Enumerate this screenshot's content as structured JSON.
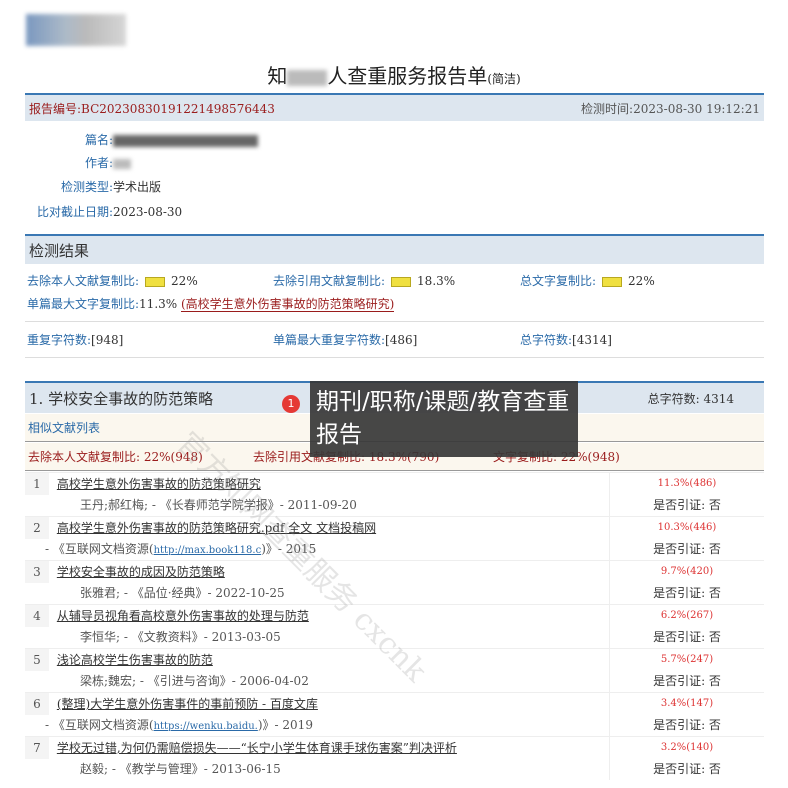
{
  "logo": "CX 知网查重",
  "title": {
    "prefix": "知",
    "suffix": "人查重服务报告单",
    "note": "(简洁)"
  },
  "report": {
    "id_label": "报告编号:",
    "id": "BC20230830191221498576443",
    "time_label": "检测时间:",
    "time": "2023-08-30 19:12:21"
  },
  "fields": {
    "title_label": "篇名:",
    "author_label": "作者:",
    "type_label": "检测类型:",
    "type": "学术出版",
    "date_label": "比对截止日期:",
    "date": "2023-08-30"
  },
  "results": {
    "header": "检测结果",
    "self_label": "去除本人文献复制比:",
    "self": "22%",
    "quote_label": "去除引用文献复制比:",
    "quote": "18.3%",
    "total_label": "总文字复制比:",
    "total": "22%",
    "max_label": "单篇最大文字复制比:",
    "max": "11.3%",
    "max_doc": "(高校学生意外伤害事故的防范策略研究)",
    "dup_label": "重复字符数:",
    "dup": "[948]",
    "maxdup_label": "单篇最大重复字符数:",
    "maxdup": "[486]",
    "chars_label": "总字符数:",
    "chars": "[4314]"
  },
  "section": {
    "title": "1. 学校安全事故的防范策略",
    "chars": "总字符数: 4314",
    "list_label": "相似文献列表",
    "self": "去除本人文献复制比: 22%(948)",
    "quote": "去除引用文献复制比: 18.3%(790)",
    "text": "文字复制比: 22%(948)"
  },
  "items": [
    {
      "n": "1",
      "title": "高校学生意外伤害事故的防范策略研究",
      "pct": "11.3%(486)",
      "meta": "王丹;郝红梅; - 《长春师范学院学报》- 2011-09-20",
      "link": "",
      "meta2": "",
      "cite": "是否引证: 否"
    },
    {
      "n": "2",
      "title": "高校学生意外伤害事故的防范策略研究.pdf 全文 文档投稿网",
      "pct": "10.3%(446)",
      "meta": "- 《互联网文档资源(",
      "link": "http://max.book118.c",
      "meta2": ")》- 2015",
      "cite": "是否引证: 否"
    },
    {
      "n": "3",
      "title": "学校安全事故的成因及防范策略",
      "pct": "9.7%(420)",
      "meta": "张雅君; - 《品位·经典》- 2022-10-25",
      "link": "",
      "meta2": "",
      "cite": "是否引证: 否"
    },
    {
      "n": "4",
      "title": "从辅导员视角看高校意外伤害事故的处理与防范",
      "pct": "6.2%(267)",
      "meta": "李恒华; - 《文教资料》- 2013-03-05",
      "link": "",
      "meta2": "",
      "cite": "是否引证: 否"
    },
    {
      "n": "5",
      "title": "浅论高校学生伤害事故的防范",
      "pct": "5.7%(247)",
      "meta": "梁栋;魏宏; - 《引进与咨询》- 2006-04-02",
      "link": "",
      "meta2": "",
      "cite": "是否引证: 否"
    },
    {
      "n": "6",
      "title": "(整理)大学生意外伤害事件的事前预防 - 百度文库",
      "pct": "3.4%(147)",
      "meta": "- 《互联网文档资源(",
      "link": "https://wenku.baidu.",
      "meta2": ")》- 2019",
      "cite": "是否引证: 否"
    },
    {
      "n": "7",
      "title": "学校无过错,为何仍需赔偿损失——“长宁小学生体育课手球伤害案”判决评析",
      "pct": "3.2%(140)",
      "meta": "赵毅; - 《教学与管理》- 2013-06-15",
      "link": "",
      "meta2": "",
      "cite": "是否引证: 否"
    }
  ],
  "overlay": {
    "badge": "1",
    "text": "期刊/职称/课题/教育查重报告"
  },
  "watermark": "官方知网查重服务 cxcnk"
}
